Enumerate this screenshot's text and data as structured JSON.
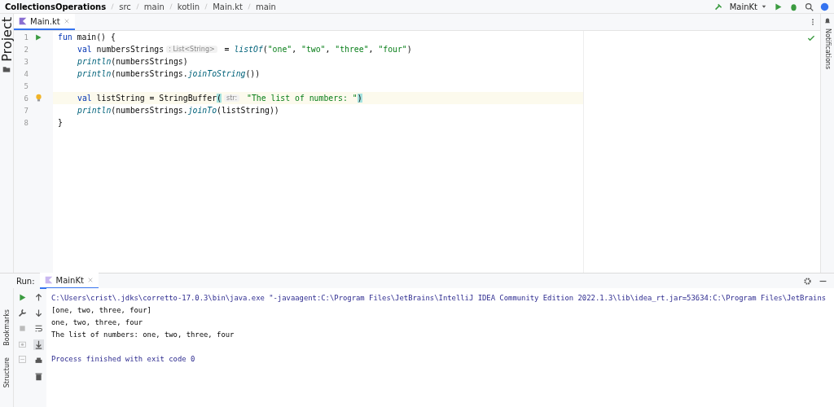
{
  "breadcrumbs": [
    "CollectionsOperations",
    "src",
    "main",
    "kotlin",
    "Main.kt",
    "main"
  ],
  "run_config": {
    "label": "MainKt"
  },
  "left_strip": [
    "Project"
  ],
  "right_strip": [
    "Notifications"
  ],
  "editor": {
    "tabs": [
      {
        "label": "Main.kt",
        "selected": true
      }
    ],
    "lines": [
      {
        "number": "1",
        "runnable": true,
        "intention": false,
        "current": false,
        "indented": false,
        "segments": [
          {
            "kind": "kw",
            "text": "fun "
          },
          {
            "kind": "plain",
            "text": "main() {"
          }
        ]
      },
      {
        "number": "2",
        "runnable": false,
        "intention": false,
        "current": false,
        "indented": true,
        "segments": [
          {
            "kind": "kw",
            "text": "val "
          },
          {
            "kind": "plain",
            "text": "numbersStrings"
          },
          {
            "kind": "hint",
            "text": ": List<String>"
          },
          {
            "kind": "plain",
            "text": " = "
          },
          {
            "kind": "fn",
            "text": "listOf"
          },
          {
            "kind": "plain",
            "text": "("
          },
          {
            "kind": "str",
            "text": "\"one\""
          },
          {
            "kind": "plain",
            "text": ", "
          },
          {
            "kind": "str",
            "text": "\"two\""
          },
          {
            "kind": "plain",
            "text": ", "
          },
          {
            "kind": "str",
            "text": "\"three\""
          },
          {
            "kind": "plain",
            "text": ", "
          },
          {
            "kind": "str",
            "text": "\"four\""
          },
          {
            "kind": "plain",
            "text": ")"
          }
        ]
      },
      {
        "number": "3",
        "runnable": false,
        "intention": false,
        "current": false,
        "indented": true,
        "segments": [
          {
            "kind": "fn",
            "text": "println"
          },
          {
            "kind": "plain",
            "text": "(numbersStrings)"
          }
        ]
      },
      {
        "number": "4",
        "runnable": false,
        "intention": false,
        "current": false,
        "indented": true,
        "segments": [
          {
            "kind": "fn",
            "text": "println"
          },
          {
            "kind": "plain",
            "text": "(numbersStrings."
          },
          {
            "kind": "fn",
            "text": "joinToString"
          },
          {
            "kind": "plain",
            "text": "())"
          }
        ]
      },
      {
        "number": "5",
        "runnable": false,
        "intention": false,
        "current": false
      },
      {
        "number": "6",
        "runnable": false,
        "intention": true,
        "current": true,
        "indented": true,
        "segments": [
          {
            "kind": "kw",
            "text": "val "
          },
          {
            "kind": "plain",
            "text": "listString = StringBuffer"
          },
          {
            "kind": "brace",
            "text": "("
          },
          {
            "kind": "hint",
            "text": "str:"
          },
          {
            "kind": "str",
            "text": " \"The list of numbers: \""
          },
          {
            "kind": "brace",
            "text": ")"
          }
        ]
      },
      {
        "number": "7",
        "runnable": false,
        "intention": false,
        "current": false,
        "indented": true,
        "segments": [
          {
            "kind": "fn",
            "text": "println"
          },
          {
            "kind": "plain",
            "text": "(numbersStrings."
          },
          {
            "kind": "fn",
            "text": "joinTo"
          },
          {
            "kind": "plain",
            "text": "(listString))"
          }
        ]
      },
      {
        "number": "8",
        "runnable": false,
        "intention": false,
        "current": false,
        "indented": false,
        "segments": [
          {
            "kind": "plain",
            "text": "}"
          }
        ]
      }
    ]
  },
  "run_panel": {
    "label": "Run:",
    "tabs": [
      {
        "label": "MainKt",
        "selected": true
      }
    ],
    "output": [
      {
        "kind": "system",
        "text": "C:\\Users\\crist\\.jdks\\corretto-17.0.3\\bin\\java.exe \"-javaagent:C:\\Program Files\\JetBrains\\IntelliJ IDEA Community Edition 2022.1.3\\lib\\idea_rt.jar=53634:C:\\Program Files\\JetBrains"
      },
      {
        "kind": "plain",
        "text": "[one, two, three, four]"
      },
      {
        "kind": "plain",
        "text": "one, two, three, four"
      },
      {
        "kind": "plain",
        "text": "The list of numbers: one, two, three, four"
      },
      {
        "kind": "blank"
      },
      {
        "kind": "system",
        "text": "Process finished with exit code 0"
      }
    ]
  },
  "bottom_strip": [
    "Bookmarks",
    "Structure"
  ]
}
